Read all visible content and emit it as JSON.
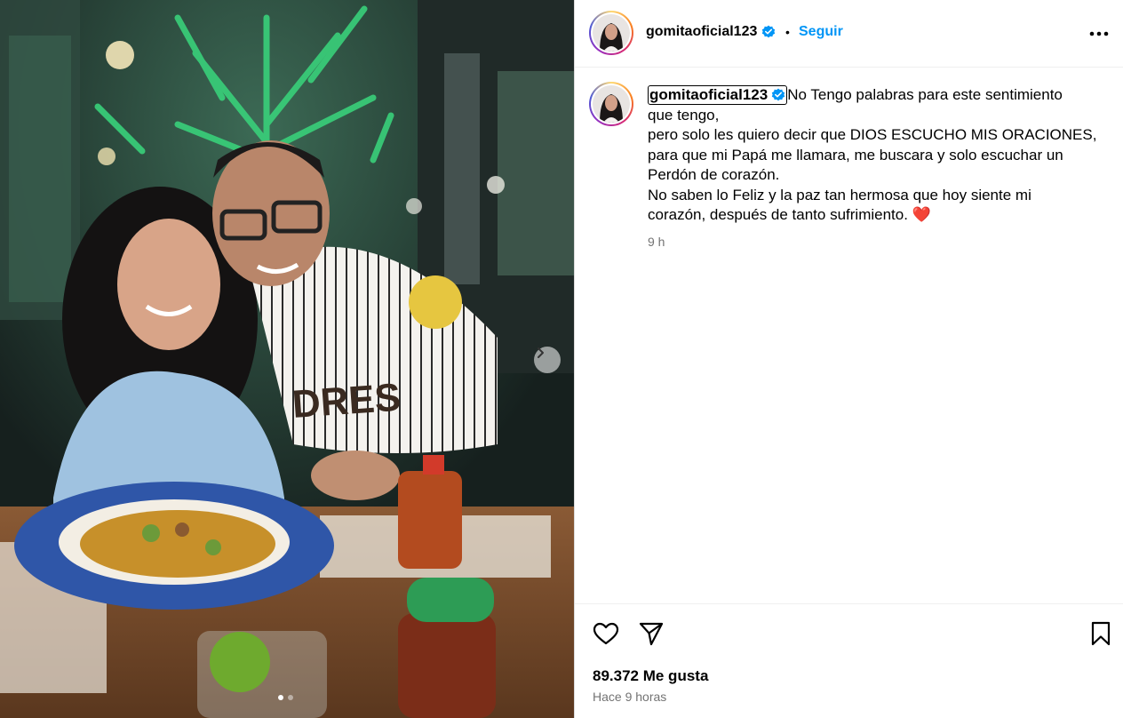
{
  "post": {
    "username": "gomitaoficial123",
    "follow_label": "Seguir",
    "separator": "•",
    "caption": {
      "line1": "No Tengo palabras para este sentimiento",
      "line2": "que tengo,",
      "line3": "pero solo les quiero decir que DIOS ESCUCHO MIS ORACIONES,",
      "line4": "para que mi Papá me llamara, me buscara y solo escuchar un",
      "line5": "Perdón de corazón.",
      "line6": "No saben lo Feliz y la paz tan hermosa que hoy siente mi",
      "line7": "corazón, después de tanto sufrimiento.",
      "emoji": "❤️"
    },
    "caption_time": "9 h",
    "likes_text": "89.372 Me gusta",
    "posted_ago": "Hace 9 horas"
  },
  "carousel": {
    "total": 2,
    "current": 1
  },
  "colors": {
    "accent": "#0095f6",
    "verified": "#0095f6",
    "muted": "#737373",
    "border": "#dbdbdb"
  },
  "icons": {
    "verified": "verified-badge-icon",
    "more": "more-options-icon",
    "like": "heart-icon",
    "share": "send-icon",
    "save": "bookmark-icon",
    "next": "chevron-right-icon"
  }
}
